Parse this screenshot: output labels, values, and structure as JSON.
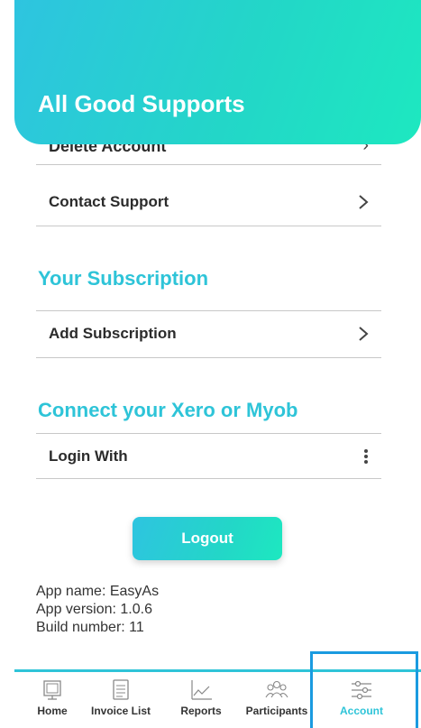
{
  "header": {
    "title": "All Good Supports"
  },
  "account_list": {
    "hidden_item": "Delete Account",
    "contact_support": "Contact Support"
  },
  "subscription": {
    "heading": "Your Subscription",
    "add_subscription": "Add Subscription"
  },
  "integration": {
    "heading": "Connect your Xero or Myob",
    "login_with": "Login With"
  },
  "logout": {
    "label": "Logout"
  },
  "app_info": {
    "app_name": "App name: EasyAs",
    "app_version": "App version: 1.0.6",
    "build_number": "Build number: 11"
  },
  "bottom_nav": {
    "items": [
      {
        "label": "Home",
        "icon": "home-icon",
        "active": false
      },
      {
        "label": "Invoice List",
        "icon": "invoice-list-icon",
        "active": false
      },
      {
        "label": "Reports",
        "icon": "reports-chart-icon",
        "active": false
      },
      {
        "label": "Participants",
        "icon": "participants-icon",
        "active": false
      },
      {
        "label": "Account",
        "icon": "sliders-icon",
        "active": true
      }
    ]
  },
  "colors": {
    "accent": "#2ec4d8",
    "gradient_start": "#2ec4e0",
    "gradient_end": "#1de8c0",
    "focus": "#1a9be0"
  }
}
